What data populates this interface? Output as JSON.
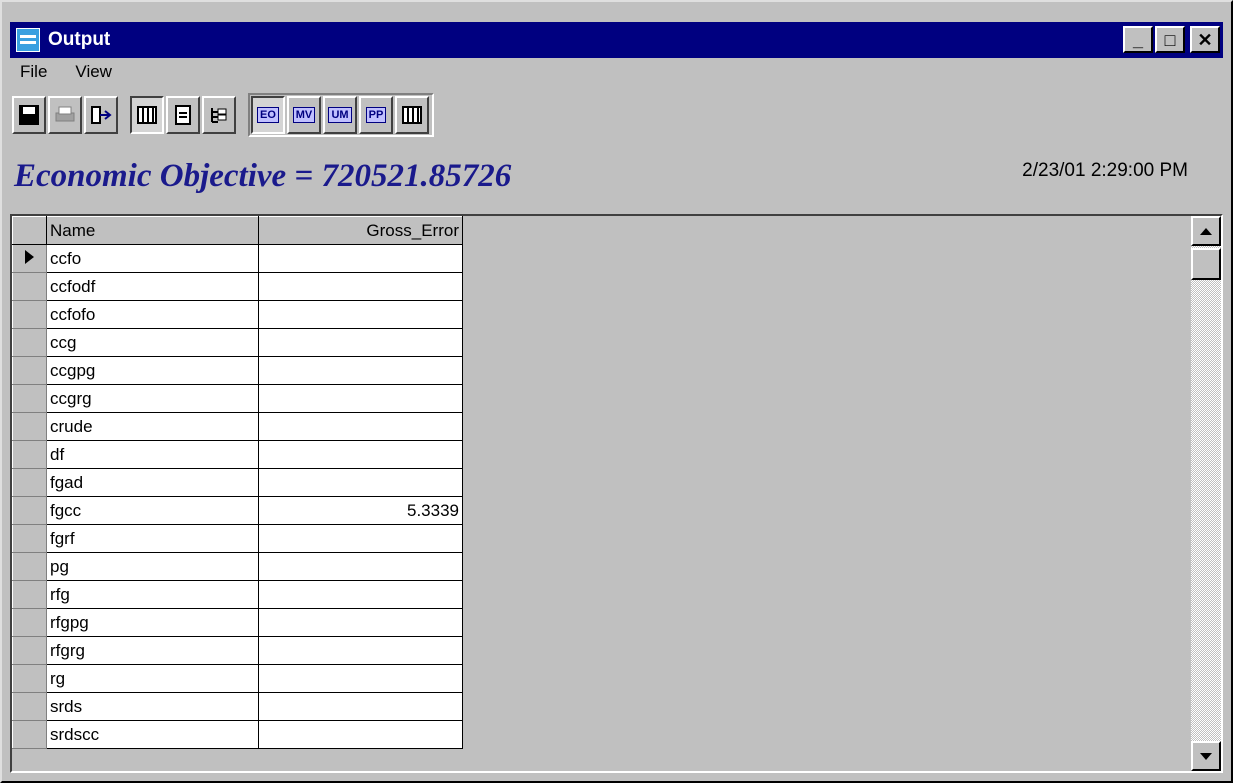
{
  "window": {
    "title": "Output",
    "minimize": "_",
    "maximize": "□",
    "close": "✕"
  },
  "menu": {
    "file": "File",
    "view": "View"
  },
  "toolbar": {
    "buttons": [
      {
        "icon": "save-icon"
      },
      {
        "icon": "print-icon"
      },
      {
        "icon": "exit-icon"
      },
      {
        "icon": "grid-view-icon"
      },
      {
        "icon": "document-view-icon"
      },
      {
        "icon": "tree-view-icon"
      },
      {
        "icon": "economic-objective-icon",
        "label": "EO"
      },
      {
        "icon": "measured-values-icon",
        "label": "MV"
      },
      {
        "icon": "unmeasured-icon",
        "label": "UM"
      },
      {
        "icon": "plant-parameters-icon",
        "label": "PP"
      },
      {
        "icon": "table-icon"
      }
    ]
  },
  "heading": "Economic Objective = 720521.85726",
  "timestamp": "2/23/01 2:29:00 PM",
  "table": {
    "columns": [
      "Name",
      "Gross_Error"
    ],
    "rows": [
      {
        "name": "ccfo",
        "error": ""
      },
      {
        "name": "ccfodf",
        "error": ""
      },
      {
        "name": "ccfofo",
        "error": ""
      },
      {
        "name": "ccg",
        "error": ""
      },
      {
        "name": "ccgpg",
        "error": ""
      },
      {
        "name": "ccgrg",
        "error": ""
      },
      {
        "name": "crude",
        "error": ""
      },
      {
        "name": "df",
        "error": ""
      },
      {
        "name": "fgad",
        "error": ""
      },
      {
        "name": "fgcc",
        "error": "5.3339"
      },
      {
        "name": "fgrf",
        "error": ""
      },
      {
        "name": "pg",
        "error": ""
      },
      {
        "name": "rfg",
        "error": ""
      },
      {
        "name": "rfgpg",
        "error": ""
      },
      {
        "name": "rfgrg",
        "error": ""
      },
      {
        "name": "rg",
        "error": ""
      },
      {
        "name": "srds",
        "error": ""
      },
      {
        "name": "srdscc",
        "error": ""
      }
    ]
  }
}
